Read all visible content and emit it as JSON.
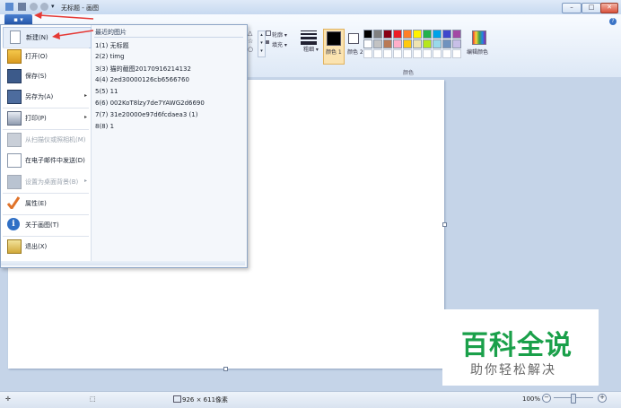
{
  "window": {
    "title": "无标题 - 画图",
    "min": "–",
    "max": "□",
    "close": "✕"
  },
  "ribbon": {
    "file_tab": "▪ ▾",
    "help": "?",
    "shapes": {
      "outline": "轮廓 ▾",
      "fill": "填充 ▾"
    },
    "size_label": "粗细 ▾",
    "color1": "颜色 1",
    "color2": "颜色 2",
    "edit_colors": "编辑颜色",
    "colors_group": "颜色",
    "palette_row1": [
      "#000000",
      "#7f7f7f",
      "#880015",
      "#ed1c24",
      "#ff7f27",
      "#fff200",
      "#22b14c",
      "#00a2e8",
      "#3f48cc",
      "#a349a4"
    ],
    "palette_row2": [
      "#ffffff",
      "#c3c3c3",
      "#b97a57",
      "#ffaec9",
      "#ffc90e",
      "#efe4b0",
      "#b5e61d",
      "#99d9ea",
      "#7092be",
      "#c8bfe7"
    ]
  },
  "menu": {
    "items": [
      {
        "label": "新建(N)",
        "icon": "new-file-icon",
        "arrow": ""
      },
      {
        "label": "打开(O)",
        "icon": "open-folder-icon",
        "arrow": ""
      },
      {
        "label": "保存(S)",
        "icon": "save-disk-icon",
        "arrow": ""
      },
      {
        "label": "另存为(A)",
        "icon": "save-as-icon",
        "arrow": "▸"
      },
      {
        "label": "打印(P)",
        "icon": "printer-icon",
        "arrow": "▸"
      },
      {
        "label": "从扫描仪或照相机(M)",
        "icon": "scanner-icon",
        "arrow": ""
      },
      {
        "label": "在电子邮件中发送(D)",
        "icon": "email-icon",
        "arrow": ""
      },
      {
        "label": "设置为桌面背景(B)",
        "icon": "desktop-background-icon",
        "arrow": "▸"
      },
      {
        "label": "属性(E)",
        "icon": "properties-check-icon",
        "arrow": ""
      },
      {
        "label": "关于画图(T)",
        "icon": "info-icon",
        "arrow": ""
      },
      {
        "label": "退出(X)",
        "icon": "exit-icon",
        "arrow": ""
      }
    ],
    "recent_title": "最近的图片",
    "recent": [
      "1(1) 无标题",
      "2(2) timg",
      "3(3) 猫的截图20170916214132",
      "4(4) 2ed30000126cb6566760",
      "5(5) 11",
      "6(6) 002KoT8lzy7de7YAWG2d6690",
      "7(7) 31e20000e97d6fcdaea3 (1)",
      "8(8) 1"
    ]
  },
  "status": {
    "move": "✛",
    "select": "⬚",
    "size": "926 × 611像素",
    "zoom": "100%",
    "zoom_out": "−",
    "zoom_in": "+"
  },
  "watermark": {
    "main": "百科全说",
    "sub": "助你轻松解决"
  },
  "colors": {
    "accent": "#2355a8",
    "arrow": "#e53935",
    "watermark_green": "#1aa04a"
  }
}
